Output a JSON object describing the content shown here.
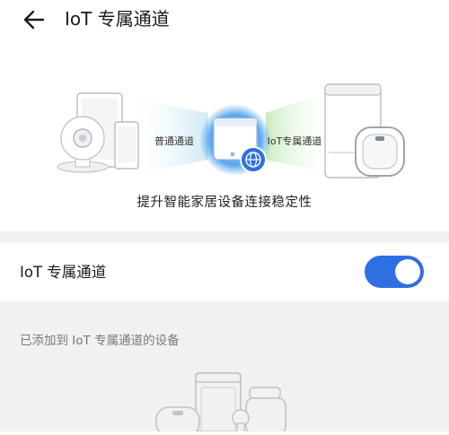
{
  "header": {
    "title": "IoT 专属通道",
    "back_icon": "arrow-left-icon"
  },
  "illustration": {
    "left_label": "普通通道",
    "right_label": "IoT专属通道",
    "tagline": "提升智能家居设备连接稳定性",
    "colors": {
      "normal_channel": "#cfeaf6",
      "iot_channel": "#c9ecc1",
      "router_glow": "#5aa8ee",
      "globe": "#2f6fe4"
    }
  },
  "toggle": {
    "label": "IoT 专属通道",
    "state": "on",
    "accent_color": "#2f6fe4"
  },
  "added_devices": {
    "caption": "已添加到 IoT 专属通道的设备"
  }
}
